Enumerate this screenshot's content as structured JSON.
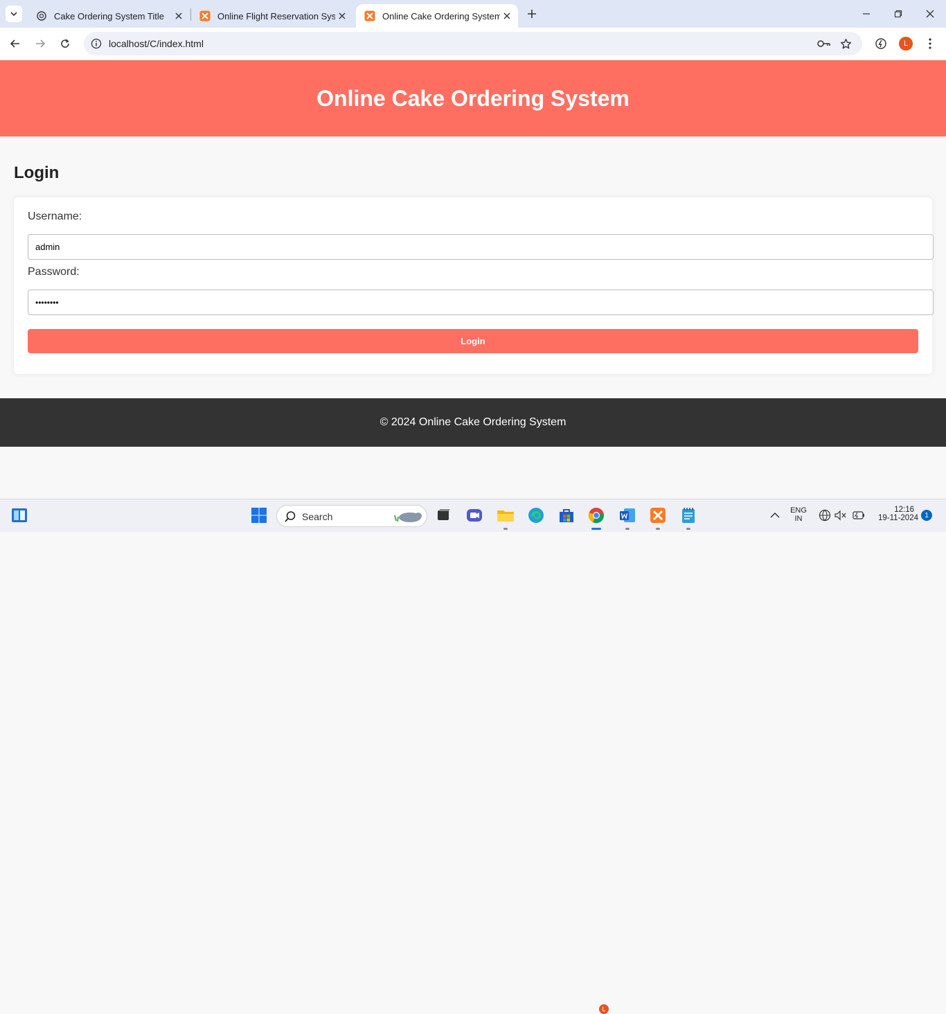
{
  "browser": {
    "tabs": [
      {
        "label": "Cake Ordering System Title",
        "active": false,
        "icon": "openai-icon"
      },
      {
        "label": "Online Flight Reservation System",
        "active": false,
        "icon": "xampp-icon"
      },
      {
        "label": "Online Cake Ordering System",
        "active": true,
        "icon": "xampp-icon"
      }
    ],
    "url": "localhost/C/index.html",
    "profile_initial": "L"
  },
  "page": {
    "header_title": "Online Cake Ordering System",
    "section_title": "Login",
    "form": {
      "username_label": "Username:",
      "username_value": "admin",
      "password_label": "Password:",
      "password_value": "••••••••",
      "submit_label": "Login"
    },
    "footer_text": "© 2024 Online Cake Ordering System"
  },
  "taskbar": {
    "search_placeholder": "Search",
    "chrome_badge": "L",
    "lang_line1": "ENG",
    "lang_line2": "IN",
    "time": "12:16",
    "date": "19-11-2024",
    "notification_count": "1"
  },
  "colors": {
    "accent": "#ff6f61",
    "footer": "#333333",
    "page_bg": "#f8f8f8"
  }
}
